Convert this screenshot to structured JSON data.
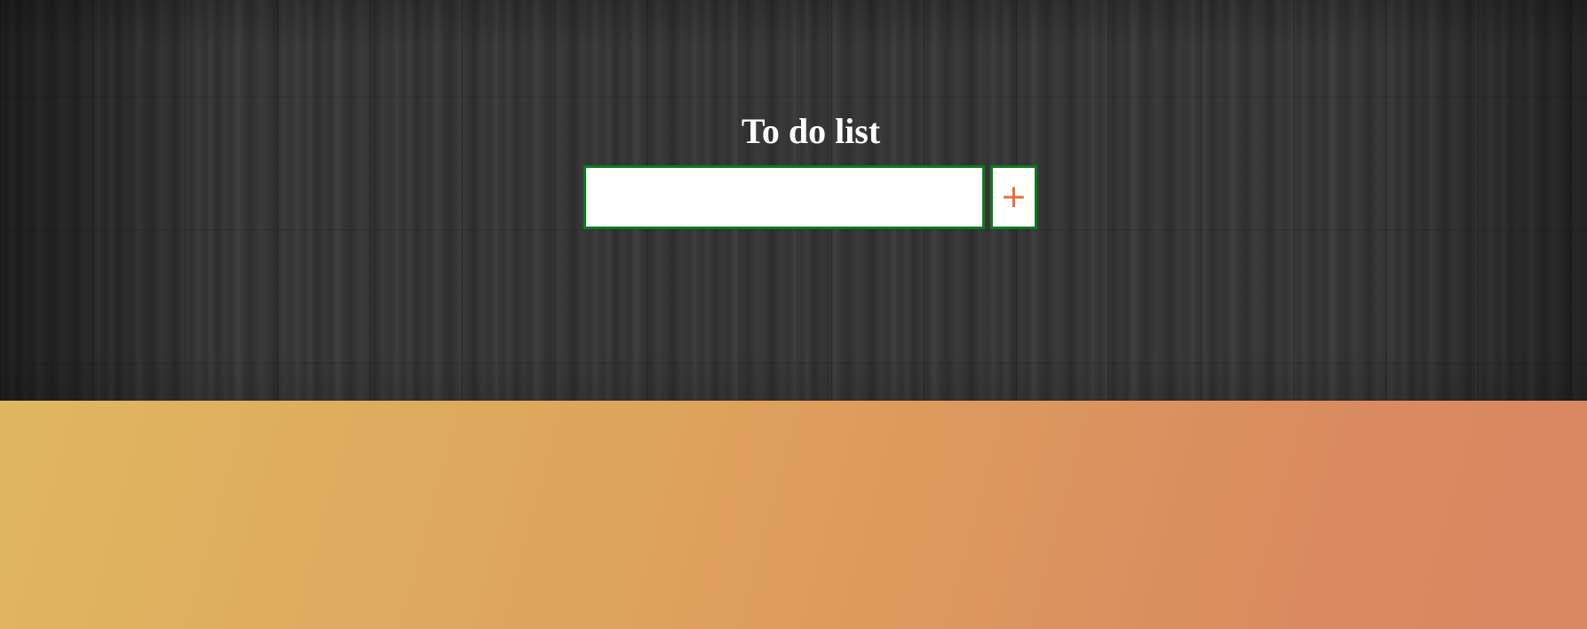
{
  "app": {
    "title": "To do list"
  },
  "add_form": {
    "input_value": "",
    "input_placeholder": "",
    "add_button_icon": "plus-icon",
    "add_button_symbol": "+"
  },
  "todos": [],
  "colors": {
    "header_background": "#2f2f2f",
    "field_border": "#0e7a1c",
    "plus_accent": "#e76d3c",
    "gradient_start": "#dfba61",
    "gradient_end": "#d98862"
  }
}
